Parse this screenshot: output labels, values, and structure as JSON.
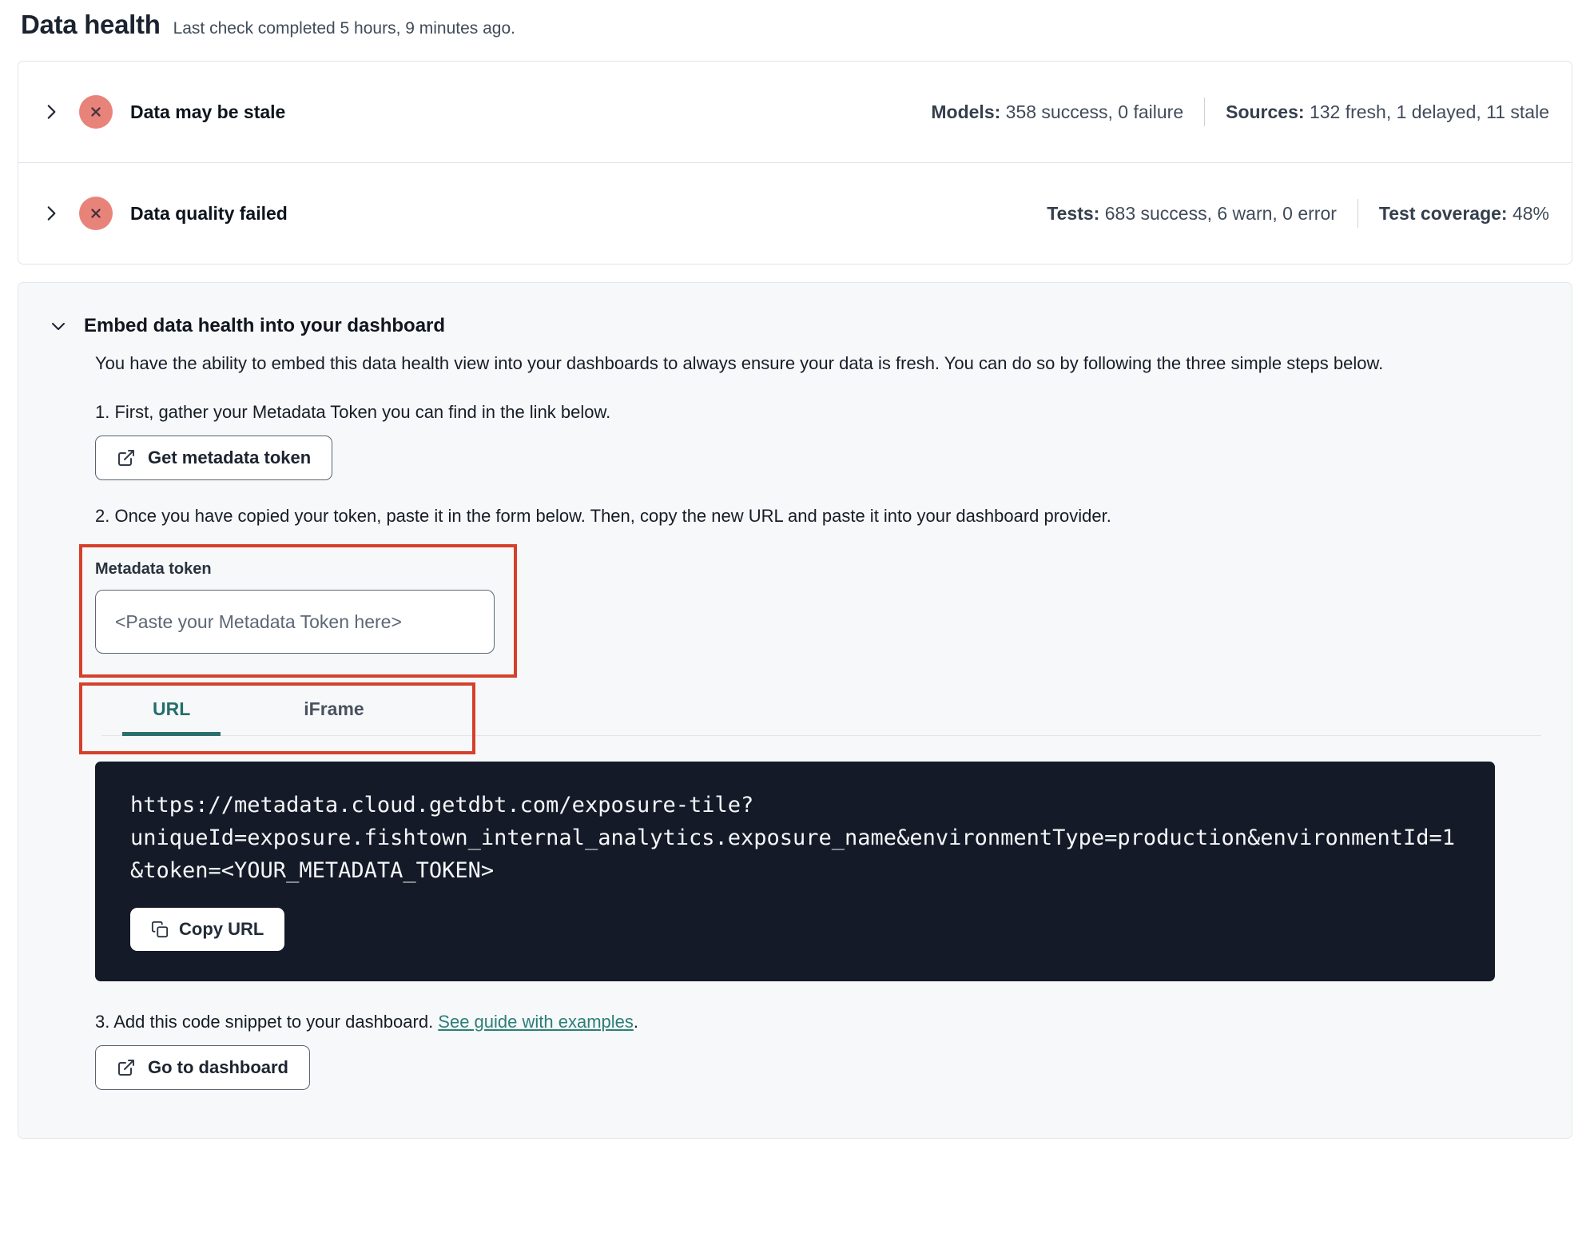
{
  "page": {
    "title": "Data health",
    "subtitle": "Last check completed 5 hours, 9 minutes ago."
  },
  "status_rows": [
    {
      "label": "Data may be stale",
      "status_icon": "x-circle",
      "stats": [
        {
          "label": "Models:",
          "value": "358 success, 0 failure"
        },
        {
          "label": "Sources:",
          "value": "132 fresh, 1 delayed, 11 stale"
        }
      ]
    },
    {
      "label": "Data quality failed",
      "status_icon": "x-circle",
      "stats": [
        {
          "label": "Tests:",
          "value": "683 success, 6 warn, 0 error"
        },
        {
          "label": "Test coverage:",
          "value": "48%"
        }
      ]
    }
  ],
  "embed": {
    "title": "Embed data health into your dashboard",
    "description": "You have the ability to embed this data health view into your dashboards to always ensure your data is fresh. You can do so by following the three simple steps below.",
    "step1": "1. First, gather your Metadata Token you can find in the link below.",
    "get_token_button": "Get metadata token",
    "step2": "2. Once you have copied your token, paste it in the form below. Then, copy the new URL and paste it into your dashboard provider.",
    "token_field": {
      "label": "Metadata token",
      "placeholder": "<Paste your Metadata Token here>",
      "value": ""
    },
    "tabs": [
      {
        "label": "URL",
        "active": true
      },
      {
        "label": "iFrame",
        "active": false
      }
    ],
    "code_url": "https://metadata.cloud.getdbt.com/exposure-tile?uniqueId=exposure.fishtown_internal_analytics.exposure_name&environmentType=production&environmentId=1&token=<YOUR_METADATA_TOKEN>",
    "copy_button": "Copy URL",
    "step3_prefix": "3. Add this code snippet to your dashboard. ",
    "step3_link": "See guide with examples",
    "step3_suffix": ".",
    "dashboard_button": "Go to dashboard"
  },
  "colors": {
    "accent_teal": "#2b6f6c",
    "error_badge": "#e8837a",
    "annotation_red": "#d5402c",
    "code_background": "#151a28"
  }
}
